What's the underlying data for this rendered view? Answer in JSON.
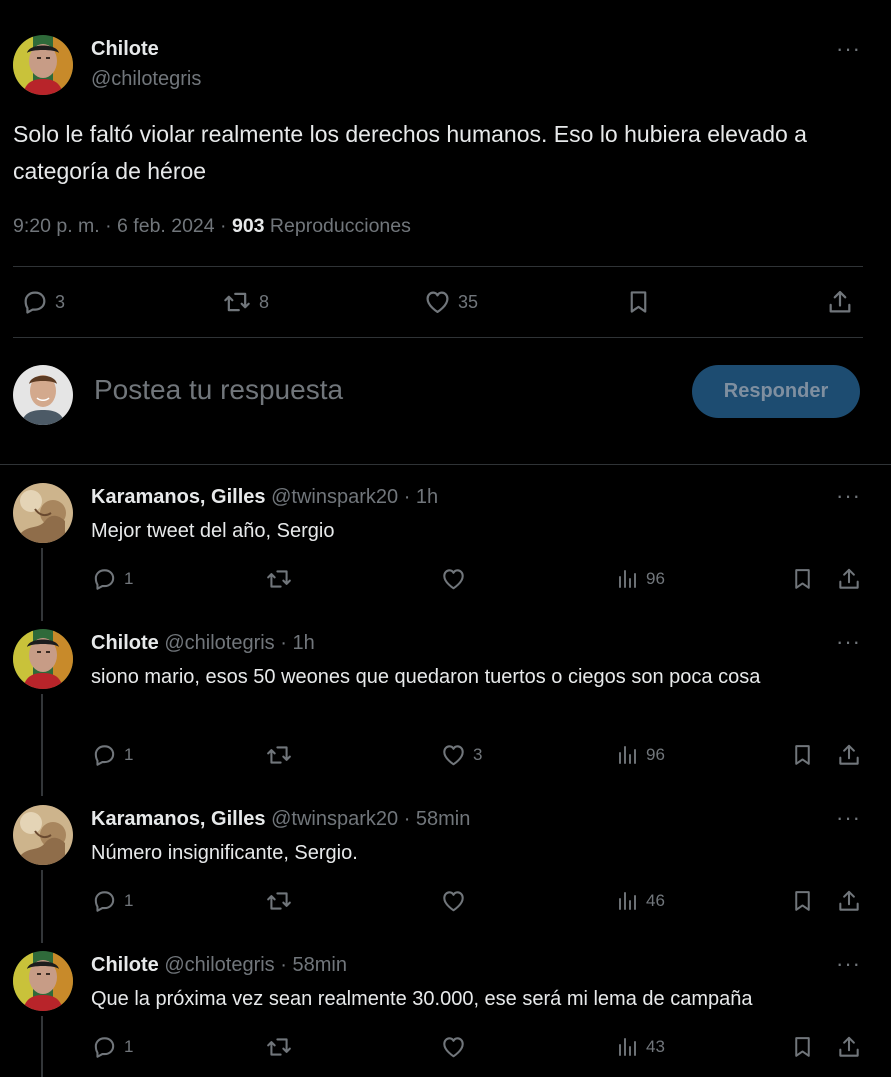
{
  "main_tweet": {
    "author_name": "Chilote",
    "author_handle": "@chilotegris",
    "text": "Solo le faltó violar realmente los derechos humanos. Eso lo hubiera elevado a categoría de héroe",
    "time": "9:20 p. m. · 6 feb. 2024 · ",
    "views_count": "903",
    "views_label": " Reproducciones",
    "replies": "3",
    "reposts": "8",
    "likes": "35"
  },
  "composer": {
    "placeholder": "Postea tu respuesta",
    "button_label": "Responder"
  },
  "replies": [
    {
      "name": "Karamanos, Gilles",
      "handle": "@twinspark20",
      "time": "· 1h",
      "text": "Mejor tweet del año, Sergio",
      "replies": "1",
      "reposts": "",
      "likes": "",
      "views": "96"
    },
    {
      "name": "Chilote",
      "handle": "@chilotegris",
      "time": "· 1h",
      "text": "siono mario, esos 50 weones que quedaron tuertos o ciegos son poca cosa",
      "replies": "1",
      "reposts": "",
      "likes": "3",
      "views": "96"
    },
    {
      "name": "Karamanos, Gilles",
      "handle": "@twinspark20",
      "time": "· 58min",
      "text": "Número insignificante, Sergio.",
      "replies": "1",
      "reposts": "",
      "likes": "",
      "views": "46"
    },
    {
      "name": "Chilote",
      "handle": "@chilotegris",
      "time": "· 58min",
      "text": "Que la próxima vez sean realmente 30.000, ese será mi lema de campaña",
      "replies": "1",
      "reposts": "",
      "likes": "",
      "views": "43"
    }
  ],
  "more_glyph": "···",
  "colors": {
    "background": "#000000",
    "text": "#e7e9ea",
    "muted": "#71767b",
    "divider": "#2f3336",
    "button": "#1d4c71"
  }
}
